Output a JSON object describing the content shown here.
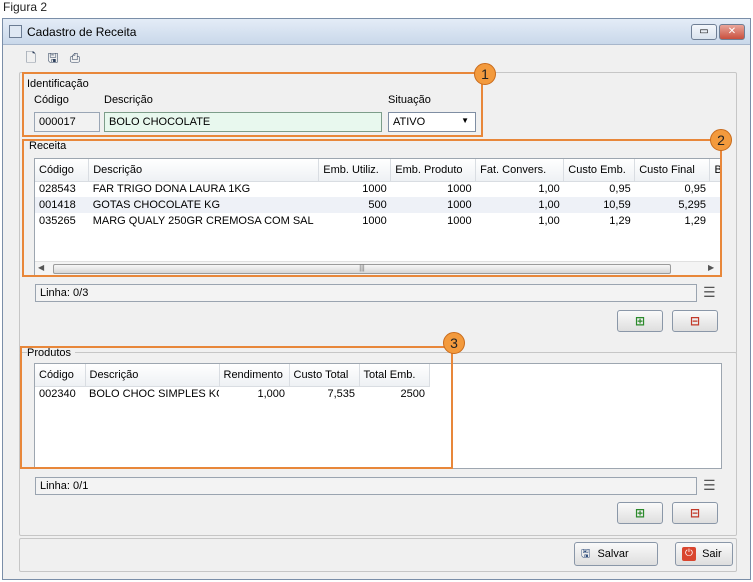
{
  "caption": "Figura 2",
  "window": {
    "title": "Cadastro de Receita",
    "controls": {
      "restore": "▭",
      "close": "✕"
    }
  },
  "toolbar": {
    "icons": [
      "new-document-icon",
      "save-disk-icon",
      "print-icon"
    ]
  },
  "identificacao": {
    "group_label": "Identificação",
    "codigo_label": "Código",
    "descricao_label": "Descrição",
    "situacao_label": "Situação",
    "codigo_value": "000017",
    "descricao_value": "BOLO CHOCOLATE",
    "situacao_value": "ATIVO"
  },
  "receita": {
    "group_label": "Receita",
    "columns": [
      "Código",
      "Descrição",
      "Emb. Utiliz.",
      "Emb. Produto",
      "Fat. Convers.",
      "Custo Emb.",
      "Custo Final",
      "Baixa Este"
    ],
    "rows": [
      {
        "codigo": "028543",
        "descricao": "FAR TRIGO DONA LAURA 1KG",
        "emb_util": "1000",
        "emb_prod": "1000",
        "fat": "1,00",
        "custo_emb": "0,95",
        "custo_final": "0,95",
        "baixa": true
      },
      {
        "codigo": "001418",
        "descricao": "GOTAS CHOCOLATE KG",
        "emb_util": "500",
        "emb_prod": "1000",
        "fat": "1,00",
        "custo_emb": "10,59",
        "custo_final": "5,295",
        "baixa": true
      },
      {
        "codigo": "035265",
        "descricao": "MARG QUALY 250GR CREMOSA COM SAL",
        "emb_util": "1000",
        "emb_prod": "1000",
        "fat": "1,00",
        "custo_emb": "1,29",
        "custo_final": "1,29",
        "baixa": true
      }
    ],
    "status": "Linha: 0/3"
  },
  "produtos": {
    "group_label": "Produtos",
    "columns": [
      "Código",
      "Descrição",
      "Rendimento",
      "Custo Total",
      "Total Emb."
    ],
    "rows": [
      {
        "codigo": "002340",
        "descricao": "BOLO CHOC SIMPLES KG",
        "rendimento": "1,000",
        "custo_total": "7,535",
        "total_emb": "2500"
      }
    ],
    "status": "Linha: 0/1"
  },
  "footer": {
    "salvar_label": "Salvar",
    "sair_label": "Sair"
  },
  "callouts": [
    "1",
    "2",
    "3"
  ],
  "colors": {
    "highlight": "#e8873a",
    "badge": "#f39a3d",
    "desc_field": "#e8f8ee"
  }
}
